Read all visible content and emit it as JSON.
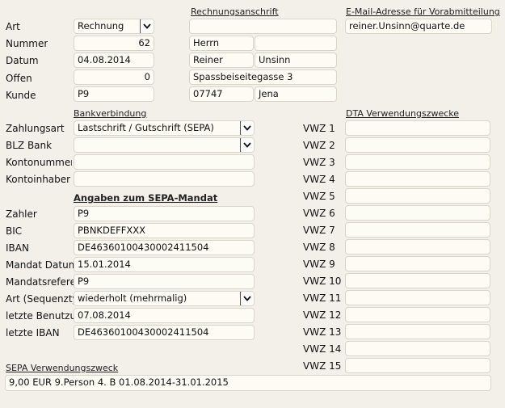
{
  "labels": {
    "art": "Art",
    "nummer": "Nummer",
    "datum": "Datum",
    "offen": "Offen",
    "kunde": "Kunde",
    "zahlungsart": "Zahlungsart",
    "blz_bank": "BLZ Bank",
    "kontonummer": "Kontonummer",
    "kontoinhaber": "Kontoinhaber",
    "zahler": "Zahler",
    "bic": "BIC",
    "iban": "IBAN",
    "mandat_datum": "Mandat Datum",
    "mandatsreferenz": "Mandatsreferenz",
    "art_sequenztyp": "Art (Sequenztyp)",
    "letzte_benutzung": "letzte Benutzung",
    "letzte_iban": "letzte IBAN"
  },
  "sections": {
    "rechnungsanschrift": "Rechnungsanschrift",
    "email_header": "E-Mail-Adresse für Vorabmitteilung",
    "bankverbindung": "Bankverbindung",
    "dta": "DTA Verwendungszwecke",
    "sepa_mandat": "Angaben zum SEPA-Mandat",
    "sepa_vwz": "SEPA Verwendungszweck"
  },
  "header": {
    "art": "Rechnung",
    "nummer": "62",
    "datum": "04.08.2014",
    "offen": "0",
    "kunde": "P9"
  },
  "address": {
    "line0": "",
    "anrede": "Herrn",
    "anrede2": "",
    "vorname": "Reiner",
    "nachname": "Unsinn",
    "strasse": "Spassbeiseitegasse 3",
    "plz": "07747",
    "ort": "Jena"
  },
  "email": "reiner.Unsinn@quarte.de",
  "bank": {
    "zahlungsart": "Lastschrift / Gutschrift (SEPA)",
    "blz_bank": "",
    "kontonummer": "",
    "kontoinhaber": ""
  },
  "sepa": {
    "zahler": "P9",
    "bic": "PBNKDEFFXXX",
    "iban": "DE46360100430002411504",
    "mandat_datum": "15.01.2014",
    "mandatsreferenz": "P9",
    "art_sequenztyp": "wiederholt (mehrmalig)",
    "letzte_benutzung": "07.08.2014",
    "letzte_iban": "DE46360100430002411504",
    "verwendungszweck": "9,00 EUR 9.Person 4. B 01.08.2014-31.01.2015"
  },
  "vwz_labels": [
    "VWZ 1",
    "VWZ 2",
    "VWZ 3",
    "VWZ 4",
    "VWZ 5",
    "VWZ 6",
    "VWZ 7",
    "VWZ 8",
    "VWZ 9",
    "VWZ 10",
    "VWZ 11",
    "VWZ 12",
    "VWZ 13",
    "VWZ 14",
    "VWZ 15"
  ],
  "vwz_values": [
    "",
    "",
    "",
    "",
    "",
    "",
    "",
    "",
    "",
    "",
    "",
    "",
    "",
    "",
    ""
  ],
  "icons": {
    "dropdown": "chevron-down-icon"
  }
}
